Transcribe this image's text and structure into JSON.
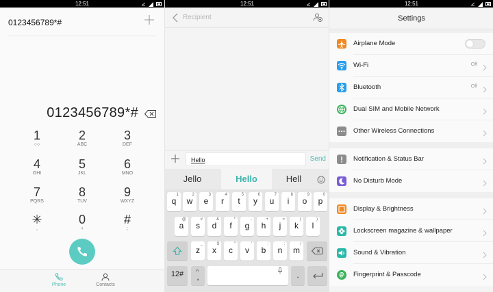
{
  "status": {
    "time": "12:51"
  },
  "dialer": {
    "recent_number": "0123456789*#",
    "display_number": "0123456789*#",
    "keys": [
      {
        "digit": "1",
        "letters": "○○"
      },
      {
        "digit": "2",
        "letters": "ABC"
      },
      {
        "digit": "3",
        "letters": "DEF"
      },
      {
        "digit": "4",
        "letters": "GHI"
      },
      {
        "digit": "5",
        "letters": "JKL"
      },
      {
        "digit": "6",
        "letters": "MNO"
      },
      {
        "digit": "7",
        "letters": "PQRS"
      },
      {
        "digit": "8",
        "letters": "TUV"
      },
      {
        "digit": "9",
        "letters": "WXYZ"
      },
      {
        "digit": "✳",
        "letters": ","
      },
      {
        "digit": "0",
        "letters": "+"
      },
      {
        "digit": "#",
        "letters": ";"
      }
    ],
    "tabs": {
      "phone": "Phone",
      "contacts": "Contacts"
    },
    "accent": "#5cccc3"
  },
  "message": {
    "recipient_placeholder": "Recipient",
    "input_text": "Hello",
    "send_label": "Send",
    "suggestions": [
      "Jello",
      "Hello",
      "Hell"
    ],
    "row1": [
      {
        "k": "q",
        "s": "1"
      },
      {
        "k": "w",
        "s": "2"
      },
      {
        "k": "e",
        "s": "3"
      },
      {
        "k": "r",
        "s": "4"
      },
      {
        "k": "t",
        "s": "5"
      },
      {
        "k": "y",
        "s": "6"
      },
      {
        "k": "u",
        "s": "7"
      },
      {
        "k": "i",
        "s": "8"
      },
      {
        "k": "o",
        "s": "9"
      },
      {
        "k": "p",
        "s": "0"
      }
    ],
    "row2": [
      {
        "k": "a",
        "s": "@"
      },
      {
        "k": "s",
        "s": "#"
      },
      {
        "k": "d",
        "s": "&"
      },
      {
        "k": "f",
        "s": "*"
      },
      {
        "k": "g",
        "s": "-"
      },
      {
        "k": "h",
        "s": "+"
      },
      {
        "k": "j",
        "s": "="
      },
      {
        "k": "k",
        "s": "("
      },
      {
        "k": "l",
        "s": ")"
      }
    ],
    "row3": [
      {
        "k": "z",
        "s": "_"
      },
      {
        "k": "x",
        "s": "$"
      },
      {
        "k": "c",
        "s": "\""
      },
      {
        "k": "v",
        "s": "'"
      },
      {
        "k": "b",
        "s": ":"
      },
      {
        "k": "n",
        "s": ";"
      },
      {
        "k": "m",
        "s": "/"
      }
    ],
    "key_123": "12#",
    "key_comma": ",",
    "key_period": "."
  },
  "settings": {
    "title": "Settings",
    "rows": [
      {
        "label": "Airplane Mode",
        "value": "",
        "color": "#f08a24"
      },
      {
        "label": "Wi-Fi",
        "value": "Off",
        "color": "#2a9ee8"
      },
      {
        "label": "Bluetooth",
        "value": "Off",
        "color": "#2a9ee8"
      },
      {
        "label": "Dual SIM and Mobile Network",
        "value": "",
        "color": "#3bb35a"
      },
      {
        "label": "Other Wireless Connections",
        "value": "",
        "color": "#8c8c8c"
      },
      {
        "label": "Notification & Status Bar",
        "value": "",
        "color": "#8c8c8c"
      },
      {
        "label": "No Disturb Mode",
        "value": "",
        "color": "#7a5ed6"
      },
      {
        "label": "Display & Brightness",
        "value": "",
        "color": "#f08a24"
      },
      {
        "label": "Lockscreen magazine & wallpaper",
        "value": "",
        "color": "#2ab8a8"
      },
      {
        "label": "Sound & Vibration",
        "value": "",
        "color": "#2ab8a8"
      },
      {
        "label": "Fingerprint & Passcode",
        "value": "",
        "color": "#3bb35a"
      }
    ]
  }
}
